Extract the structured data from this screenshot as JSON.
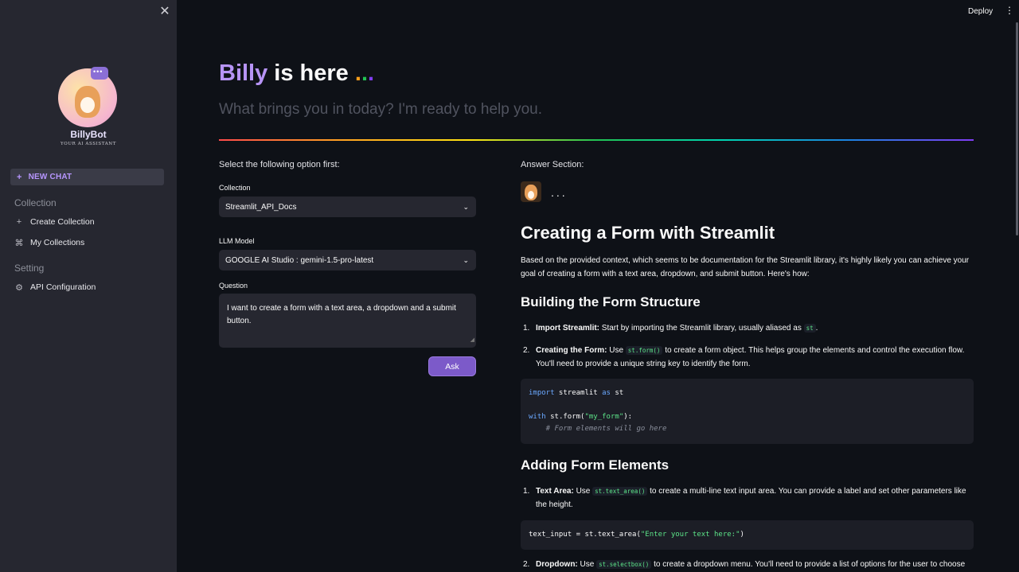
{
  "sidebar": {
    "close_label": "✕",
    "logo_name": "BillyBot",
    "logo_tagline": "YOUR AI ASSISTANT",
    "new_chat_label": "NEW CHAT",
    "collection_section": "Collection",
    "create_collection_label": "Create Collection",
    "my_collections_label": "My Collections",
    "setting_section": "Setting",
    "api_configuration_label": "API Configuration"
  },
  "topbar": {
    "deploy_label": "Deploy",
    "menu_label": "⋮"
  },
  "header": {
    "title_name": "Billy",
    "title_rest": " is here ",
    "subtitle": "What brings you in today? I'm ready to help you.",
    "dot_colors": [
      "#ff9f1c",
      "#21c354",
      "#803df5"
    ]
  },
  "form": {
    "prompt": "Select the following option first:",
    "collection_label": "Collection",
    "collection_value": "Streamlit_API_Docs",
    "llm_label": "LLM Model",
    "llm_value": "GOOGLE AI Studio : gemini-1.5-pro-latest",
    "question_label": "Question",
    "question_value": "I want to create a form with a text area, a dropdown and a submit button.",
    "ask_label": "Ask"
  },
  "answer": {
    "section_label": "Answer Section:",
    "typing": "...",
    "heading": "Creating a Form with Streamlit",
    "intro": "Based on the provided context, which seems to be documentation for the Streamlit library, it's highly likely you can achieve your goal of creating a form with a text area, dropdown, and submit button. Here's how:",
    "section1_heading": "Building the Form Structure",
    "s1_item1_title": "Import Streamlit:",
    "s1_item1_text": " Start by importing the Streamlit library, usually aliased as ",
    "s1_item1_code": "st",
    "s1_item1_end": ".",
    "s1_item2_title": "Creating the Form:",
    "s1_item2_pre": " Use ",
    "s1_item2_code": "st.form()",
    "s1_item2_text": " to create a form object. This helps group the elements and control the execution flow. You'll need to provide a unique string key to identify the form.",
    "code1": {
      "kw_import": "import",
      "mod": " streamlit ",
      "kw_as": "as",
      "alias": " st",
      "kw_with": "with",
      "call": " st.form(",
      "arg": "\"my_form\"",
      "close": "):",
      "comment": "    # Form elements will go here"
    },
    "section2_heading": "Adding Form Elements",
    "s2_item1_title": "Text Area:",
    "s2_item1_pre": " Use ",
    "s2_item1_code": "st.text_area()",
    "s2_item1_text": " to create a multi-line text input area. You can provide a label and set other parameters like the height.",
    "code2": {
      "lhs": "text_input = st.text_area(",
      "arg": "\"Enter your text here:\"",
      "close": ")"
    },
    "s2_item2_title": "Dropdown:",
    "s2_item2_pre": " Use ",
    "s2_item2_code": "st.selectbox()",
    "s2_item2_text": " to create a dropdown menu. You'll need to provide a list of options for the user to choose"
  },
  "colors": {
    "accent": "#b794f6",
    "button": "#7c5ac9",
    "background": "#0e1117",
    "sidebar": "#262730"
  }
}
